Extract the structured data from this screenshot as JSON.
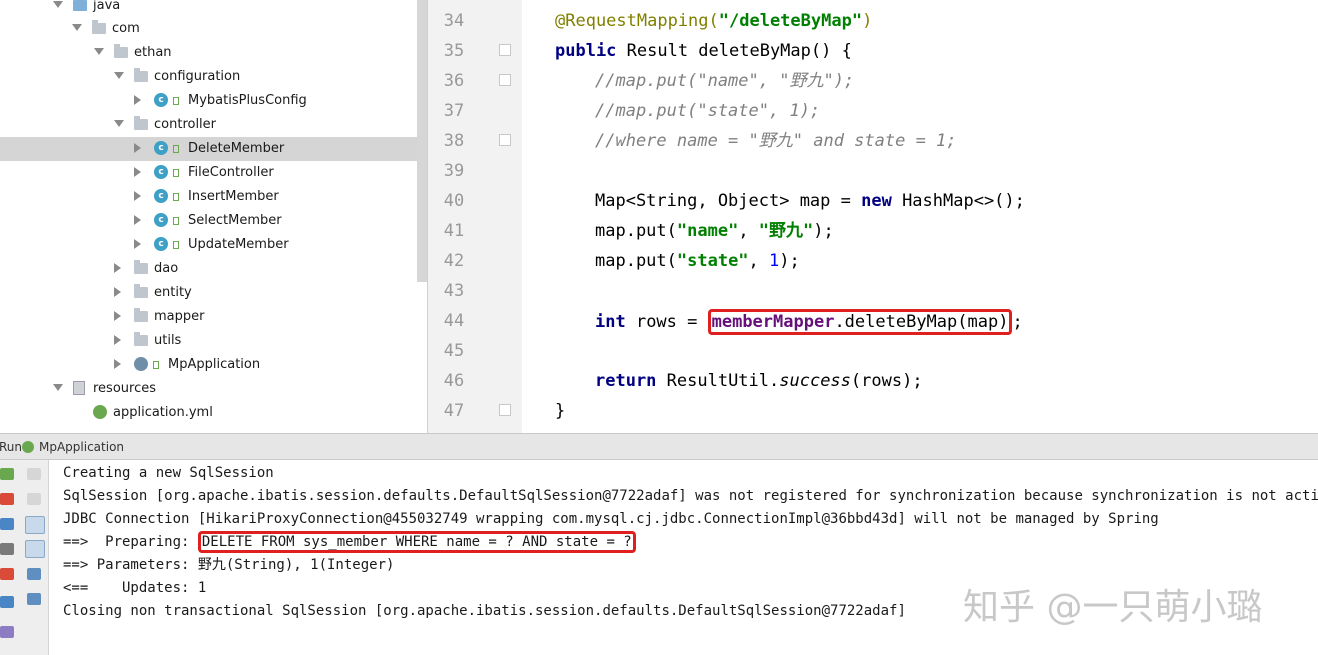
{
  "project_tree": {
    "items": [
      {
        "label": "java",
        "icon": "folder-icon",
        "expanded": true,
        "selected": false
      },
      {
        "label": "com",
        "icon": "package-icon",
        "expanded": true,
        "selected": false
      },
      {
        "label": "ethan",
        "icon": "package-icon",
        "expanded": true,
        "selected": false
      },
      {
        "label": "configuration",
        "icon": "package-icon",
        "expanded": true,
        "selected": false
      },
      {
        "label": "MybatisPlusConfig",
        "icon": "class-icon",
        "expanded": false,
        "selected": false
      },
      {
        "label": "controller",
        "icon": "package-icon",
        "expanded": true,
        "selected": false
      },
      {
        "label": "DeleteMember",
        "icon": "class-icon",
        "expanded": false,
        "selected": true
      },
      {
        "label": "FileController",
        "icon": "class-icon",
        "expanded": false,
        "selected": false
      },
      {
        "label": "InsertMember",
        "icon": "class-icon",
        "expanded": false,
        "selected": false
      },
      {
        "label": "SelectMember",
        "icon": "class-icon",
        "expanded": false,
        "selected": false
      },
      {
        "label": "UpdateMember",
        "icon": "class-icon",
        "expanded": false,
        "selected": false
      },
      {
        "label": "dao",
        "icon": "package-icon",
        "expanded": false,
        "selected": false
      },
      {
        "label": "entity",
        "icon": "package-icon",
        "expanded": false,
        "selected": false
      },
      {
        "label": "mapper",
        "icon": "package-icon",
        "expanded": false,
        "selected": false
      },
      {
        "label": "utils",
        "icon": "package-icon",
        "expanded": false,
        "selected": false
      },
      {
        "label": "MpApplication",
        "icon": "spring-boot-class-icon",
        "expanded": false,
        "selected": false
      },
      {
        "label": "resources",
        "icon": "resources-folder-icon",
        "expanded": true,
        "selected": false
      },
      {
        "label": "application.yml",
        "icon": "spring-config-icon",
        "expanded": false,
        "selected": false
      }
    ]
  },
  "editor": {
    "line_numbers": [
      "34",
      "35",
      "36",
      "37",
      "38",
      "39",
      "40",
      "41",
      "42",
      "43",
      "44",
      "45",
      "46",
      "47"
    ],
    "lines": {
      "l34_annotation": "@RequestMapping(",
      "l34_string": "\"/deleteByMap\"",
      "l34_close": ")",
      "l35_kw": "public",
      "l35_rest": " Result deleteByMap() {",
      "l36_comment": "//map.put(\"name\", \"野九\");",
      "l37_comment": "//map.put(\"state\", 1);",
      "l38_comment": "//where name = \"野九\" and state = 1;",
      "l40_a": "Map<String, Object> map = ",
      "l40_kw": "new",
      "l40_b": " HashMap<>();",
      "l41_a": "map.put(",
      "l41_s1": "\"name\"",
      "l41_b": ", ",
      "l41_s2": "\"野九\"",
      "l41_c": ");",
      "l42_a": "map.put(",
      "l42_s1": "\"state\"",
      "l42_b": ", ",
      "l42_num": "1",
      "l42_c": ");",
      "l44_kw": "int",
      "l44_a": " rows = ",
      "l44_field": "memberMapper",
      "l44_call": ".deleteByMap(map)",
      "l44_end": ";",
      "l46_kw": "return",
      "l46_a": " ResultUtil.",
      "l46_method": "success",
      "l46_b": "(rows);",
      "l47": "}"
    }
  },
  "run_panel": {
    "tab_label": "Run",
    "config_name": "MpApplication",
    "console_lines": {
      "c1": "Creating a new SqlSession",
      "c2": "SqlSession [org.apache.ibatis.session.defaults.DefaultSqlSession@7722adaf] was not registered for synchronization because synchronization is not active",
      "c3": "JDBC Connection [HikariProxyConnection@455032749 wrapping com.mysql.cj.jdbc.ConnectionImpl@36bbd43d] will not be managed by Spring",
      "c4_prefix": "==>  Preparing: ",
      "c4_sql": "DELETE FROM sys_member WHERE name = ? AND state = ?",
      "c5": "==> Parameters: 野九(String), 1(Integer)",
      "c6": "<==    Updates: 1",
      "c7": "Closing non transactional SqlSession [org.apache.ibatis.session.defaults.DefaultSqlSession@7722adaf]"
    }
  },
  "watermark": "知乎 @一只萌小璐",
  "colors": {
    "highlight_box": "#e0201f",
    "selection": "#d5d5d5",
    "string": "#008000",
    "keyword": "#000080",
    "annotation": "#808000",
    "comment": "#808080"
  }
}
